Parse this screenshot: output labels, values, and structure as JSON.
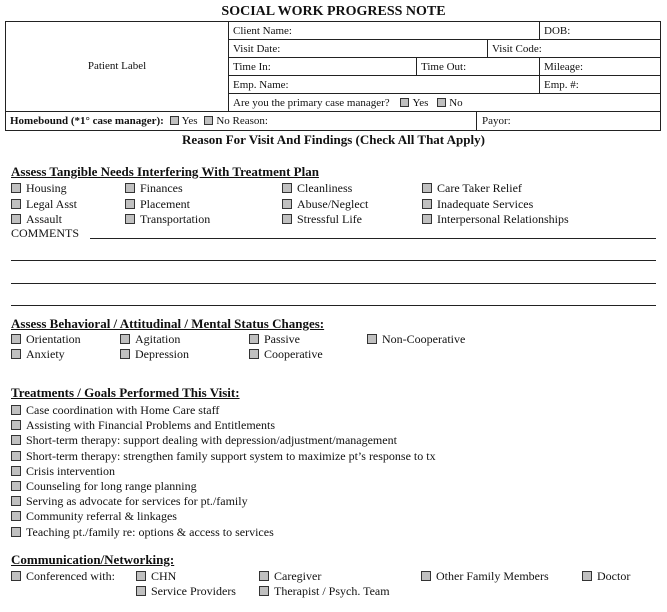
{
  "title": "SOCIAL WORK PROGRESS NOTE",
  "header": {
    "patient_label": "Patient Label",
    "client_name": "Client Name:",
    "dob": "DOB:",
    "visit_date": "Visit Date:",
    "visit_code": "Visit Code:",
    "time_in": "Time In:",
    "time_out": "Time Out:",
    "mileage": "Mileage:",
    "emp_name": "Emp. Name:",
    "emp_num": "Emp. #:",
    "primary_cm_q": "Are you the primary case manager?",
    "yes": "Yes",
    "no": "No",
    "homebound": "Homebound (*1° case manager):",
    "no_reason": "No Reason:",
    "payor": "Payor:"
  },
  "reason_heading": "Reason For Visit And Findings (Check All That Apply)",
  "tangible": {
    "heading": "Assess  Tangible Needs Interfering With Treatment  Plan",
    "items": [
      "Housing",
      "Finances",
      "Cleanliness",
      "Care Taker Relief",
      "Legal Asst",
      "Placement",
      "Abuse/Neglect",
      "Inadequate Services",
      "Assault",
      "Transportation",
      "Stressful Life",
      "Interpersonal Relationships"
    ],
    "comments": "COMMENTS"
  },
  "behavioral": {
    "heading": "Assess  Behavioral / Attitudinal / Mental Status Changes:",
    "items": [
      "Orientation",
      "Agitation",
      "Passive",
      "Non-Cooperative",
      "Anxiety",
      "Depression",
      "Cooperative"
    ]
  },
  "treatments": {
    "heading": "Treatments / Goals Performed This Visit:",
    "items": [
      "Case coordination with Home Care staff",
      "Assisting  with Financial Problems and Entitlements",
      "Short-term therapy: support dealing with depression/adjustment/management",
      "Short-term therapy: strengthen family support system to maximize pt’s response to tx",
      "Crisis  intervention",
      "Counseling for long range planning",
      "Serving as advocate for services for pt./family",
      "Community referral & linkages",
      "Teaching pt./family re: options &  access to services"
    ]
  },
  "communication": {
    "heading": "Communication/Networking:",
    "conferenced": "Conferenced with:",
    "items": [
      "CHN",
      "Caregiver",
      "Other Family Members",
      "Doctor",
      "Service Providers",
      "Therapist / Psych. Team"
    ]
  }
}
